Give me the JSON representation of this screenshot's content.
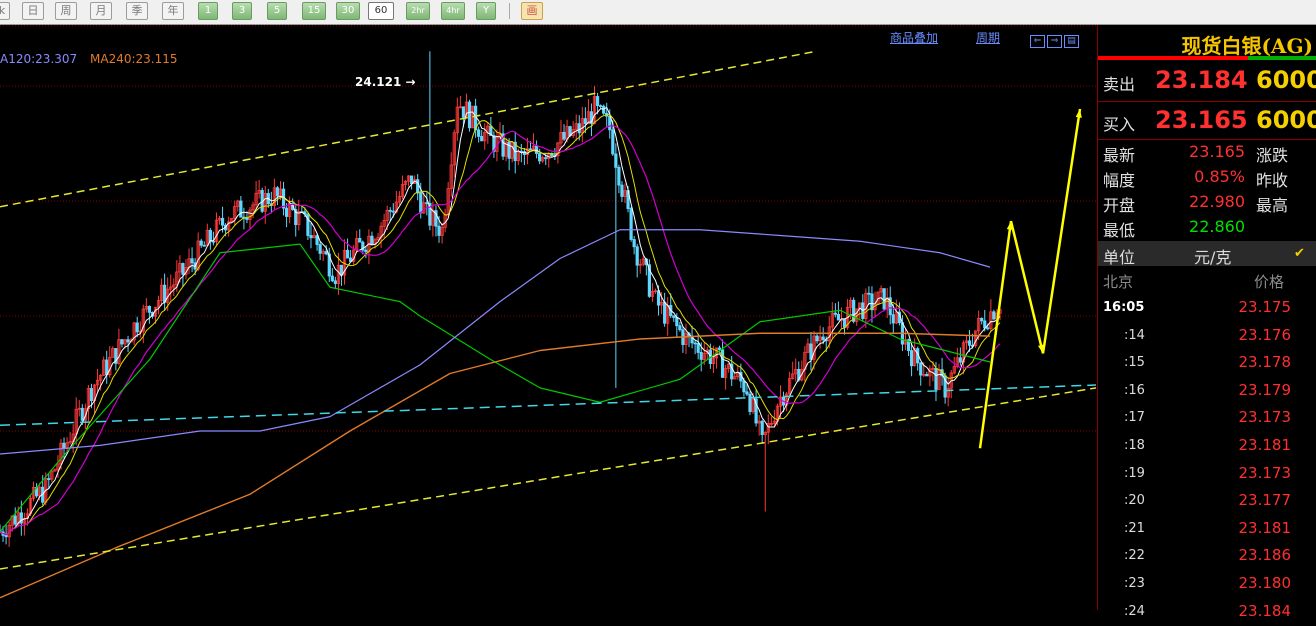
{
  "toolbar": {
    "periods": [
      "日",
      "周",
      "月",
      "季",
      "年"
    ],
    "minutes": [
      "1",
      "3",
      "5",
      "15",
      "30",
      "60",
      "2hr",
      "4hr",
      "Y"
    ],
    "active_minute": "60",
    "tool_label": "画"
  },
  "chart": {
    "ma_labels": {
      "ma120": "A120:23.307",
      "ma240": "MA240:23.115"
    },
    "links": {
      "overlay": "商品叠加",
      "period": "周期"
    },
    "zoom_icons": [
      "zoom-in-icon",
      "zoom-out-icon",
      "layout-icon"
    ],
    "peak_label": "24.121",
    "colors": {
      "up": "#ff3a3a",
      "down": "#5fd7ff",
      "ma5": "#ffffff",
      "ma10": "#e0e000",
      "ma20": "#d000d0",
      "ma60": "#00c800",
      "ma120": "#8a89ff",
      "ma240": "#e07b2a",
      "trend": "#e8e830",
      "support": "#40d8e8",
      "forecast": "#ffff00",
      "grid": "#8a0000"
    }
  },
  "chart_data": {
    "type": "candlestick",
    "instrument": "现货白银(AG)",
    "y_gridlines": [
      24.0,
      23.6,
      23.2,
      22.8
    ],
    "peak_high": 24.121,
    "indicators": {
      "MA120": 23.307,
      "MA240": 23.115
    },
    "candles": [],
    "ma5": [],
    "ma10": [],
    "ma20": [],
    "ma60": [],
    "ma120": [],
    "ma240": [],
    "forecast_path": [
      [
        0,
        22.74
      ],
      [
        1,
        23.53
      ],
      [
        2,
        23.07
      ],
      [
        3,
        23.92
      ]
    ]
  },
  "quote": {
    "title": "现货白银(AG)",
    "sell": {
      "label": "卖出",
      "price": "23.184",
      "volume": "6000"
    },
    "buy": {
      "label": "买入",
      "price": "23.165",
      "volume": "6000"
    },
    "info": [
      {
        "name": "最新",
        "value": "23.165",
        "color": "#ff3030",
        "name2": "涨跌"
      },
      {
        "name": "幅度",
        "value": "0.85%",
        "color": "#ff3030",
        "name2": "昨收"
      },
      {
        "name": "开盘",
        "value": "22.980",
        "color": "#ff3030",
        "name2": "最高"
      },
      {
        "name": "最低",
        "value": "22.860",
        "color": "#00e000",
        "name2": ""
      }
    ],
    "unit": {
      "label": "单位",
      "value": "元/克",
      "check": "✔"
    },
    "ticks_header": {
      "city": "北京",
      "price": "价格"
    },
    "ticks": [
      {
        "time": "16:05",
        "price": "23.175"
      },
      {
        "time": ":14",
        "price": "23.176"
      },
      {
        "time": ":15",
        "price": "23.178"
      },
      {
        "time": ":16",
        "price": "23.179"
      },
      {
        "time": ":17",
        "price": "23.173"
      },
      {
        "time": ":18",
        "price": "23.181"
      },
      {
        "time": ":19",
        "price": "23.173"
      },
      {
        "time": ":20",
        "price": "23.177"
      },
      {
        "time": ":21",
        "price": "23.181"
      },
      {
        "time": ":22",
        "price": "23.186"
      },
      {
        "time": ":23",
        "price": "23.180"
      },
      {
        "time": ":24",
        "price": "23.184"
      }
    ]
  }
}
